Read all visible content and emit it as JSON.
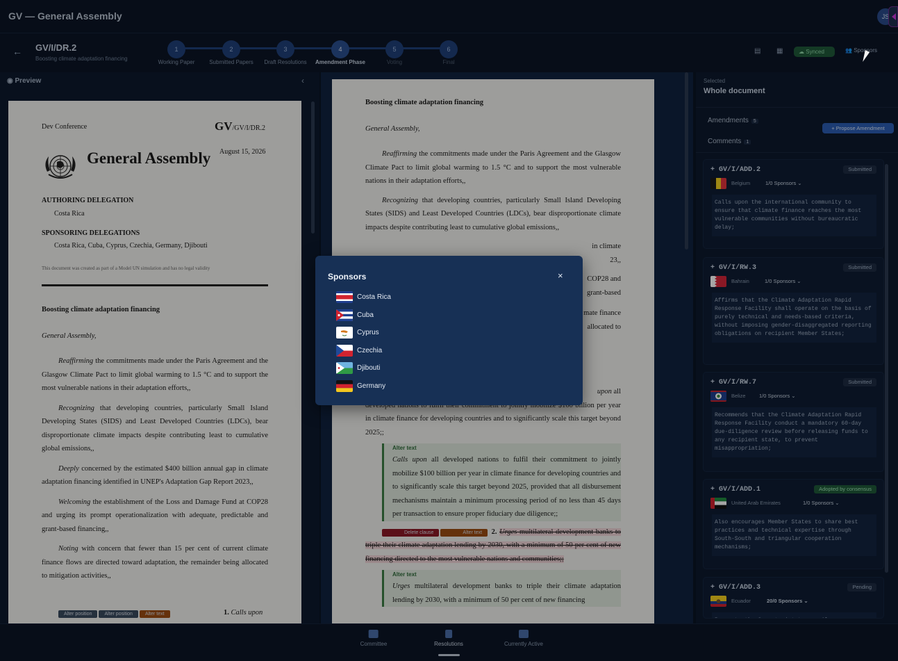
{
  "app": {
    "title": "GV — General Assembly",
    "avatar": "JS"
  },
  "header": {
    "back": "←",
    "code": "GV/I/DR.2",
    "subtitle": "Boosting climate adaptation financing",
    "steps": [
      {
        "n": "1",
        "label": "Working Paper"
      },
      {
        "n": "2",
        "label": "Submitted Papers"
      },
      {
        "n": "3",
        "label": "Draft Resolutions"
      },
      {
        "n": "4",
        "label": "Amendment Phase"
      },
      {
        "n": "5",
        "label": "Voting"
      },
      {
        "n": "6",
        "label": "Final"
      }
    ],
    "synced": "Synced",
    "sponsors": "Sponsors"
  },
  "preview": {
    "label": "Preview",
    "collapse": "‹",
    "conference": "Dev Conference",
    "gv": "GV",
    "gv_code": "/GV/I/DR.2",
    "title": "General Assembly",
    "date": "August 15, 2026",
    "authoring_heading": "AUTHORING DELEGATION",
    "authoring": "Costa Rica",
    "sponsoring_heading": "SPONSORING DELEGATIONS",
    "sponsoring": "Costa Rica, Cuba, Cyprus, Czechia, Germany, Djibouti",
    "disclaimer": "This document was created as part of a Model UN simulation and has no legal validity",
    "doc_title": "Boosting climate adaptation financing",
    "preamble": "General Assembly,",
    "paragraphs": [
      {
        "lead": "Reaffirming",
        "text": " the commitments made under the Paris Agreement and the Glasgow Climate Pact to limit global warming to 1.5 °C and to support the most vulnerable nations in their adaptation efforts,,"
      },
      {
        "lead": "Recognizing",
        "text": " that developing countries, particularly Small Island Developing States (SIDS) and Least Developed Countries (LDCs), bear disproportionate climate impacts despite contributing least to cumulative global emissions,,"
      },
      {
        "lead": "Deeply",
        "text": " concerned by the estimated $400 billion annual gap in climate adaptation financing identified in UNEP's Adaptation Gap Report 2023,,"
      },
      {
        "lead": "Welcoming",
        "text": " the establishment of the Loss and Damage Fund at COP28 and urging its prompt operationalization with adequate, predictable and grant-based financing,,"
      },
      {
        "lead": "Noting",
        "text": " with concern that fewer than 15 per cent of current climate finance flows are directed toward adaptation, the remainder being allocated to mitigation activities,,"
      }
    ],
    "tags": [
      "Alter position",
      "Alter position",
      "Alter text"
    ],
    "clause_num": "1.",
    "clause_start": "Calls upon"
  },
  "center": {
    "doc_title": "Boosting climate adaptation financing",
    "preamble": "General Assembly,",
    "p1_lead": "Reaffirming",
    "p1": " the commitments made under the Paris Agreement and the Glasgow Climate Pact to limit global warming to 1.5 °C and to support the most vulnerable nations in their adaptation efforts,,",
    "p2_lead": "Recognizing",
    "p2": " that developing countries, particularly Small Island Developing States (SIDS) and Least Developed Countries (LDCs), bear disproportionate climate impacts despite contributing least to cumulative global emissions,,",
    "p3_tail": "in climate",
    "p3_tail2": "23,,",
    "p4_tail": "COP28 and",
    "p4_tail2": "grant-based",
    "p5_tail": "mate finance",
    "p5_tail2": "allocated to",
    "calls_tail": "upon all",
    "clause1": "developed nations to fulfil their commitment to jointly mobilize $100 billion per year in climate finance for developing countries and to significantly scale this target beyond 2025;;",
    "alter1_title": "Alter text",
    "alter1_lead": "Calls upon",
    "alter1": " all developed nations to fulfil their commitment to jointly mobilize $100 billion per year in climate finance for developing countries and to significantly scale this target beyond 2025, provided that all disbursement mechanisms maintain a minimum processing period of no less than 45 days per transaction to ensure proper fiduciary due diligence;;",
    "tag_delete": "Delete clause",
    "tag_alter": "Alter text",
    "clause2_num": "2.",
    "clause2_lead": "Urges",
    "clause2": " multilateral development banks to triple their climate adaptation lending by 2030, with a minimum of 50 per cent of new financing directed to the most vulnerable nations and communities;;",
    "alter2_title": "Alter text",
    "alter2_lead": "Urges",
    "alter2": " multilateral development banks to triple their climate adaptation lending by 2030, with a minimum of 50 per cent of new financing"
  },
  "right": {
    "selected_label": "Selected",
    "selected": "Whole document",
    "amendments_tab": "Amendments",
    "amendments_count": "5",
    "comments_tab": "Comments",
    "comments_count": "1",
    "propose": "+ Propose Amendment",
    "cards": [
      {
        "code": "+ GV/I/ADD.2",
        "status": "Submitted",
        "country": "Belgium",
        "sponsors": "1/0 Sponsors ⌄",
        "flag": "belgium",
        "text": "Calls upon the international community to ensure that climate finance reaches the most vulnerable communities without bureaucratic delay;"
      },
      {
        "code": "+ GV/I/RW.3",
        "status": "Submitted",
        "country": "Bahrain",
        "sponsors": "1/0 Sponsors ⌄",
        "flag": "bahrain",
        "text": "Affirms that the Climate Adaptation Rapid Response Facility shall operate on the basis of purely technical and needs-based criteria, without imposing gender-disaggregated reporting obligations on recipient Member States;"
      },
      {
        "code": "+ GV/I/RW.7",
        "status": "Submitted",
        "country": "Belize",
        "sponsors": "1/0 Sponsors ⌄",
        "flag": "belize",
        "text": "Recommends that the Climate Adaptation Rapid Response Facility conduct a mandatory 60-day due-diligence review before releasing funds to any recipient state, to prevent misappropriation;"
      },
      {
        "code": "+ GV/I/ADD.1",
        "status": "Adopted by consensus",
        "country": "United Arab Emirates",
        "sponsors": "1/0 Sponsors ⌄",
        "flag": "uae",
        "text": "Also encourages Member States to share best practices and technical expertise through South-South and triangular cooperation mechanisms;"
      },
      {
        "code": "+ GV/I/ADD.3",
        "status": "Pending",
        "country": "Ecuador",
        "sponsors": "20/0 Sponsors ⌄",
        "flag": "ecuador",
        "text": "Requests the Secretariat to compile a"
      }
    ]
  },
  "nav": {
    "items": [
      {
        "label": "Committee"
      },
      {
        "label": "Resolutions"
      },
      {
        "label": "Currently Active"
      }
    ]
  },
  "modal": {
    "title": "Sponsors",
    "close": "×",
    "sponsors": [
      {
        "name": "Costa Rica",
        "flag": "costa-rica"
      },
      {
        "name": "Cuba",
        "flag": "cuba"
      },
      {
        "name": "Cyprus",
        "flag": "cyprus"
      },
      {
        "name": "Czechia",
        "flag": "czechia"
      },
      {
        "name": "Djibouti",
        "flag": "djibouti"
      },
      {
        "name": "Germany",
        "flag": "germany"
      }
    ]
  },
  "colors": {
    "accent": "#2c5db3",
    "synced": "#1f5a3a",
    "adopted": "#1f5a3a",
    "delete": "#8c1a27",
    "alter": "#9b4c12"
  }
}
